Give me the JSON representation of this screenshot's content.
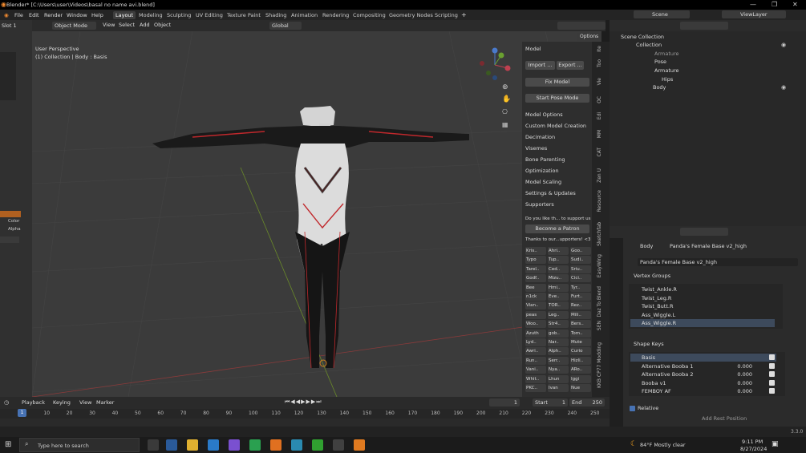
{
  "window": {
    "title": "Blender* [C:\\Users\\user\\Videos\\basal no name avi.blend]"
  },
  "menu": [
    "File",
    "Edit",
    "Render",
    "Window",
    "Help"
  ],
  "workspaces": [
    "Layout",
    "Modeling",
    "Sculpting",
    "UV Editing",
    "Texture Paint",
    "Shading",
    "Animation",
    "Rendering",
    "Compositing",
    "Geometry Nodes",
    "Scripting"
  ],
  "scene": {
    "label": "Scene",
    "view_layer": "ViewLayer"
  },
  "left_header": {
    "slot": "Slot 1"
  },
  "viewport": {
    "mode": "Object Mode",
    "menus": [
      "View",
      "Select",
      "Add",
      "Object"
    ],
    "transform": "Global",
    "perspective": "User Perspective",
    "collection": "(1) Collection | Body : Basis",
    "options": "Options"
  },
  "npanel": {
    "model": "Model",
    "import": "Import ...",
    "export": "Export ...",
    "fix": "Fix Model",
    "pose": "Start Pose Mode",
    "sections": [
      "Model Options",
      "Custom Model Creation",
      "Decimation",
      "Visemes",
      "Bone Parenting",
      "Optimization",
      "Model Scaling",
      "Settings & Updates"
    ],
    "supporters": "Supporters",
    "like": "Do you like th... to support us",
    "patron": "Become a Patron",
    "thanks": "Thanks to our...upporters! <3",
    "names": [
      "Kris..",
      "Ahri..",
      "Goo..",
      "Typo",
      "Tup..",
      "Sudi..",
      "Tarel..",
      "Ced..",
      "Sriu..",
      "Godf..",
      "Mizu..",
      "Cici..",
      "Bee",
      "Hmi..",
      "Tyr..",
      "n1ck",
      "Eve..",
      "Furt..",
      "Vian..",
      "TOR..",
      "Rez..",
      "peas",
      "Leg..",
      "Mili..",
      "Woo..",
      "Str4..",
      "Bers..",
      "Azuth",
      "gob..",
      "Tom..",
      "Lyd..",
      "Nar..",
      "Mute",
      "Awri..",
      "Alph..",
      "Curio",
      "Run..",
      "Serr..",
      "Hizli..",
      "Vani..",
      "Nya..",
      "ARo..",
      "Whit..",
      "Lhun",
      "Iggi",
      "PKC..",
      "Ivan",
      "Nue",
      "Cord.."
    ]
  },
  "ntabs": [
    "Ite",
    "Too",
    "Vie",
    "OC",
    "Edi",
    "MM",
    "CAT",
    "Zen U",
    "Resource",
    "Sketchfab",
    "EasyWing",
    "Daz To Blend",
    "SEN",
    "CP77 Modding",
    "KKB"
  ],
  "outliner": {
    "root": "Scene Collection",
    "items": [
      "Collection",
      "Armature",
      "Pose",
      "Armature",
      "Hips",
      "Body"
    ]
  },
  "props": {
    "path": [
      "Body",
      "Panda's Female Base v2_high"
    ],
    "mesh": "Panda's Female Base v2_high",
    "vg_title": "Vertex Groups",
    "vgroups": [
      "Twist_Ankle.R",
      "Twist_Leg.R",
      "Twist_Butt.R",
      "Ass_Wiggle.L",
      "Ass_Wiggle.R"
    ],
    "sk_title": "Shape Keys",
    "shapekeys": [
      {
        "n": "Basis",
        "v": ""
      },
      {
        "n": "Alternative Booba 1",
        "v": "0.000"
      },
      {
        "n": "Alternative Booba 2",
        "v": "0.000"
      },
      {
        "n": "Booba v1",
        "v": "0.000"
      },
      {
        "n": "FEMBOY AF",
        "v": "0.000"
      }
    ],
    "relative": "Relative",
    "rest": "Add Rest Position"
  },
  "timeline": {
    "menus": [
      "Playback",
      "Keying",
      "View",
      "Marker"
    ],
    "frame": "1",
    "start_label": "Start",
    "start": "1",
    "end_label": "End",
    "end": "250",
    "ticks": [
      "0",
      "10",
      "20",
      "30",
      "40",
      "50",
      "60",
      "70",
      "80",
      "90",
      "100",
      "110",
      "120",
      "130",
      "140",
      "150",
      "160",
      "170",
      "180",
      "190",
      "200",
      "210",
      "220",
      "230",
      "240",
      "250"
    ],
    "version": "3.3.0"
  },
  "left_props": {
    "color": "Color",
    "alpha": "Alpha"
  },
  "taskbar": {
    "search": "Type here to search",
    "weather": "84°F  Mostly clear",
    "time": "9:11 PM",
    "date": "8/27/2024"
  },
  "colors": {
    "accent": "#4772b3",
    "active_tab": "#3d3d3d",
    "body_red": "#c0282c",
    "patron": "#e05c5c"
  }
}
